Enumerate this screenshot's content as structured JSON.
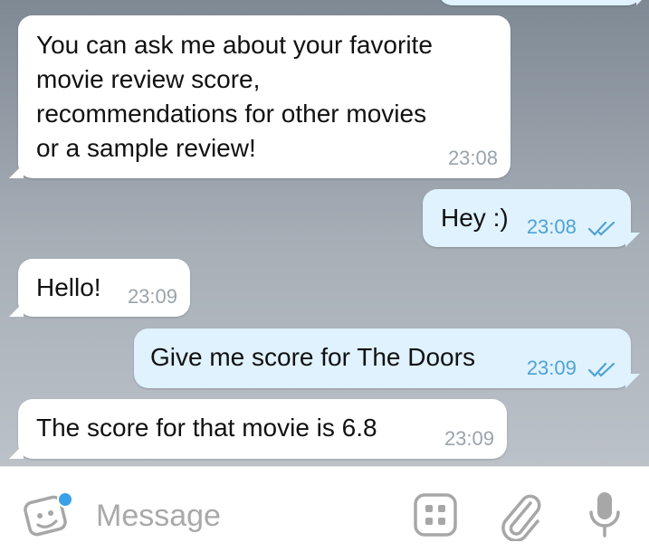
{
  "messages": [
    {
      "direction": "out",
      "text": "",
      "time": ""
    },
    {
      "direction": "in",
      "text": "You can ask me about your favorite\nmovie review score,\nrecommendations for other movies\nor a sample review!",
      "time": "23:08"
    },
    {
      "direction": "out",
      "text": "Hey :)",
      "time": "23:08",
      "status": "read"
    },
    {
      "direction": "in",
      "text": "Hello!",
      "time": "23:09"
    },
    {
      "direction": "out",
      "text": "Give me score for The Doors",
      "time": "23:09",
      "status": "read"
    },
    {
      "direction": "in",
      "text": "The score for that movie is 6.8",
      "time": "23:09"
    }
  ],
  "composer": {
    "placeholder": "Message",
    "left_icon": "sticker-icon",
    "right_icons": [
      "bot-commands-icon",
      "paperclip-icon",
      "microphone-icon"
    ]
  },
  "colors": {
    "incoming_bubble": "#ffffff",
    "outgoing_bubble": "#dff2fd",
    "outgoing_time": "#4ea2d4",
    "incoming_time": "#9aa3ab",
    "accent": "#3aa0e8"
  }
}
